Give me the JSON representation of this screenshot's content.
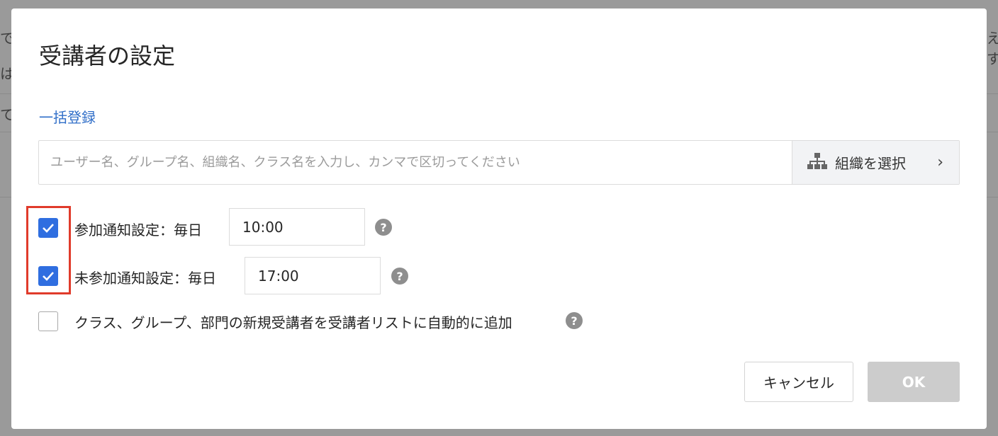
{
  "background": {
    "snippets": [
      "で",
      "は、",
      "て",
      "えす"
    ]
  },
  "modal": {
    "title": "受講者の設定",
    "bulk_register_link": "一括登録",
    "user_input": {
      "placeholder": "ユーザー名、グループ名、組織名、クラス名を入力し、カンマで区切ってください",
      "value": ""
    },
    "org_select": {
      "label": "組織を選択",
      "icon": "org-chart-icon",
      "chevron": "›"
    },
    "options": [
      {
        "label": "参加通知設定：毎日",
        "checked": true,
        "time": "10:00",
        "help": "?"
      },
      {
        "label": "未参加通知設定：毎日",
        "checked": true,
        "time": "17:00",
        "help": "?"
      },
      {
        "label": "クラス、グループ、部門の新規受講者を受講者リストに自動的に追加",
        "checked": false,
        "help": "?"
      }
    ],
    "buttons": {
      "cancel": "キャンセル",
      "ok": "OK"
    }
  },
  "colors": {
    "accent": "#2f6ee0",
    "link": "#2f6ec8",
    "highlight_border": "#e03b2b",
    "ok_disabled": "#cccccc"
  }
}
